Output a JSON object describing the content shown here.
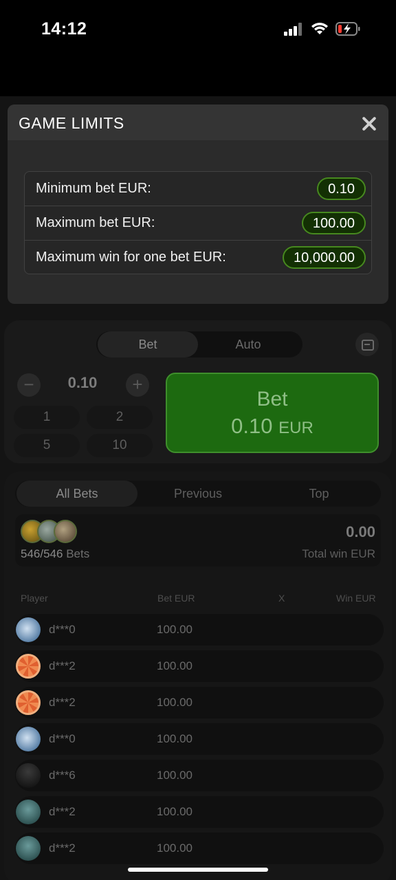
{
  "status_bar": {
    "time": "14:12",
    "icons": [
      "signal-icon",
      "wifi-icon",
      "battery-charging-icon"
    ]
  },
  "modal": {
    "title": "GAME LIMITS",
    "close_icon": "close-icon",
    "limits": [
      {
        "label": "Minimum bet EUR:",
        "value": "0.10"
      },
      {
        "label": "Maximum bet EUR:",
        "value": "100.00"
      },
      {
        "label": "Maximum win for one bet EUR:",
        "value": "10,000.00"
      }
    ]
  },
  "bet_panel": {
    "tabs": [
      {
        "label": "Bet",
        "active": true
      },
      {
        "label": "Auto",
        "active": false
      }
    ],
    "amount": "0.10",
    "minus_symbol": "−",
    "plus_symbol": "+",
    "quick_amounts": [
      "1",
      "2",
      "5",
      "10"
    ],
    "bet_button": {
      "label": "Bet",
      "amount": "0.10",
      "currency": "EUR"
    }
  },
  "bets_panel": {
    "tabs": [
      {
        "label": "All Bets",
        "active": true
      },
      {
        "label": "Previous",
        "active": false
      },
      {
        "label": "Top",
        "active": false
      }
    ],
    "bets_count": "546/546",
    "bets_word": "Bets",
    "total_win": "0.00",
    "total_win_label": "Total win EUR",
    "columns": [
      "Player",
      "Bet EUR",
      "X",
      "Win EUR"
    ],
    "rows": [
      {
        "player": "d***0",
        "bet": "100.00",
        "avatar": "plane-avatar"
      },
      {
        "player": "d***2",
        "bet": "100.00",
        "avatar": "citrus-avatar"
      },
      {
        "player": "d***2",
        "bet": "100.00",
        "avatar": "citrus-avatar"
      },
      {
        "player": "d***0",
        "bet": "100.00",
        "avatar": "plane-avatar"
      },
      {
        "player": "d***6",
        "bet": "100.00",
        "avatar": "shadow-avatar"
      },
      {
        "player": "d***2",
        "bet": "100.00",
        "avatar": "diver-avatar"
      },
      {
        "player": "d***2",
        "bet": "100.00",
        "avatar": "diver-avatar"
      }
    ]
  },
  "colors": {
    "accent_green": "#1d6a10",
    "value_pill_border": "#47891f",
    "background": "#000000"
  }
}
